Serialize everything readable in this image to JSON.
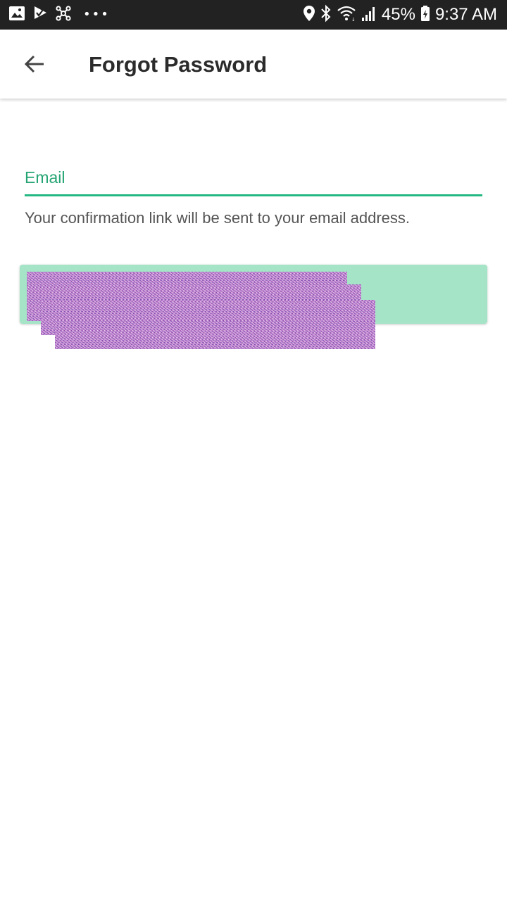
{
  "status_bar": {
    "battery": "45%",
    "time": "9:37 AM",
    "left_icons": [
      "image-icon",
      "check-flag-icon",
      "network-share-icon",
      "more-dots-icon"
    ],
    "right_icons": [
      "location-icon",
      "bluetooth-icon",
      "wifi-icon",
      "signal-icon",
      "battery-icon"
    ]
  },
  "app_bar": {
    "title": "Forgot Password",
    "back_icon": "arrow-left-icon"
  },
  "form": {
    "email_label": "Email",
    "email_value": "",
    "helper_text": "Your confirmation link will be sent to your email address.",
    "send_button_label": ""
  },
  "colors": {
    "status_bar_bg": "#222222",
    "accent": "#26a574",
    "underline": "#26b883",
    "button_bg": "#a5e4c7",
    "redaction": "#b06fc4"
  }
}
